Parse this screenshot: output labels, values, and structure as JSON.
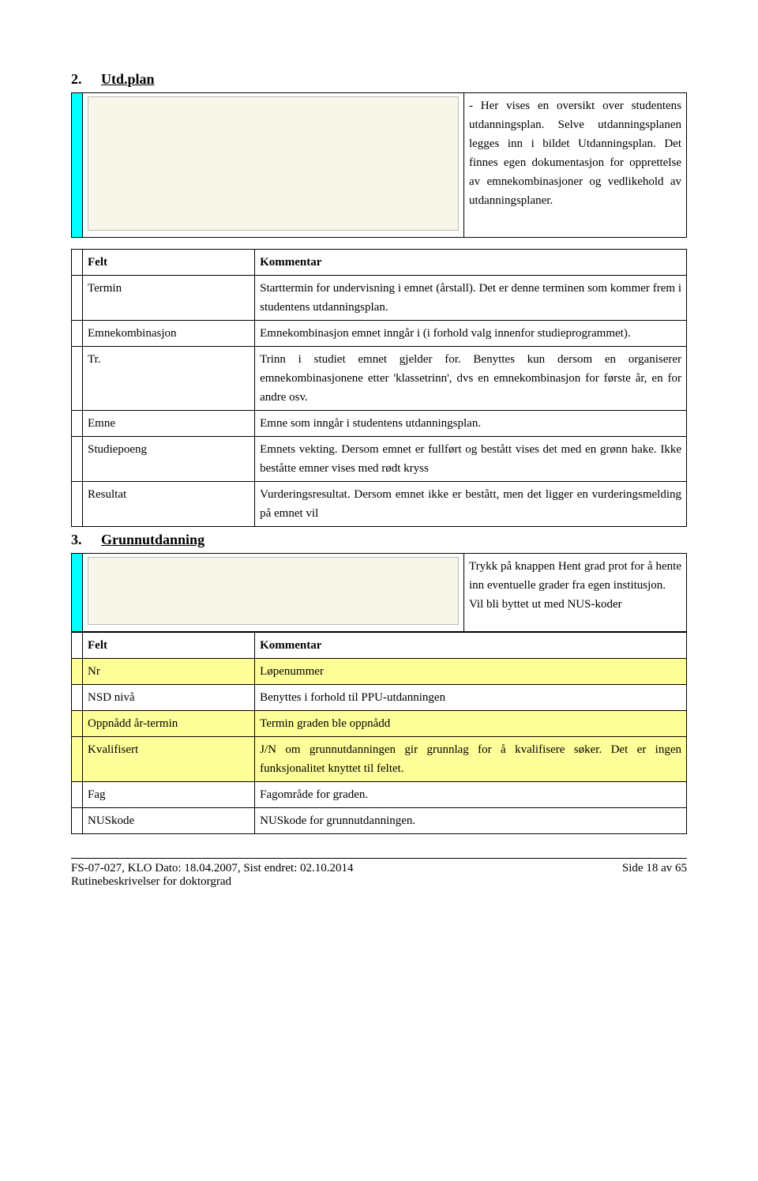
{
  "sections": {
    "s2": {
      "num": "2.",
      "title": "Utd.plan"
    },
    "s3": {
      "num": "3.",
      "title": "Grunnutdanning"
    }
  },
  "intro2": {
    "text": "- Her vises en oversikt over studentens utdanningsplan. Selve utdanningsplanen legges inn i bildet Utdanningsplan. Det finnes egen dokumentasjon for opprettelse av emnekombinasjoner og vedlikehold av utdanningsplaner."
  },
  "table2": {
    "head": {
      "felt": "Felt",
      "kommentar": "Kommentar"
    },
    "rows": {
      "termin": {
        "felt": "Termin",
        "txt": "Starttermin for undervisning i emnet (årstall). Det er denne terminen som kommer frem i studentens utdanningsplan."
      },
      "emnekomb": {
        "felt": "Emnekombinasjon",
        "txt": "Emnekombinasjon emnet inngår i (i forhold valg innenfor studieprogrammet)."
      },
      "tr": {
        "felt": "Tr.",
        "txt": "Trinn i studiet emnet gjelder for. Benyttes kun dersom en organiserer emnekombinasjonene etter 'klassetrinn', dvs en emnekombinasjon for første år, en for andre osv."
      },
      "emne": {
        "felt": "Emne",
        "txt": "Emne som inngår i studentens utdanningsplan."
      },
      "sp": {
        "felt": "Studiepoeng",
        "txt": "Emnets vekting. Dersom emnet er fullført og bestått vises det med en grønn hake. Ikke beståtte emner vises med rødt kryss"
      },
      "res": {
        "felt": "Resultat",
        "txt": "Vurderingsresultat. Dersom emnet ikke er bestått, men det ligger en vurderingsmelding på emnet vil"
      }
    }
  },
  "intro3": {
    "text": "Trykk på knappen Hent grad prot for å hente inn eventuelle grader fra egen institusjon.\nVil bli byttet ut med NUS-koder"
  },
  "table3": {
    "head": {
      "felt": "Felt",
      "kommentar": "Kommentar"
    },
    "rows": {
      "nr": {
        "felt": "Nr",
        "txt": "Løpenummer"
      },
      "nsd": {
        "felt": "NSD nivå",
        "txt": "Benyttes i forhold til PPU-utdanningen"
      },
      "opp": {
        "felt": "Oppnådd år-termin",
        "txt": "Termin graden ble oppnådd"
      },
      "kval": {
        "felt": "Kvalifisert",
        "txt": "J/N om grunnutdanningen gir grunnlag for å kvalifisere søker. Det er ingen funksjonalitet knyttet til feltet."
      },
      "fag": {
        "felt": "Fag",
        "txt": "Fagområde for graden."
      },
      "nus": {
        "felt": "NUSkode",
        "txt": "NUSkode for grunnutdanningen."
      }
    }
  },
  "footer": {
    "left1": "FS-07-027, KLO Dato: 18.04.2007, Sist endret: 02.10.2014",
    "right": "Side 18 av 65",
    "left2": "Rutinebeskrivelser for doktorgrad"
  }
}
